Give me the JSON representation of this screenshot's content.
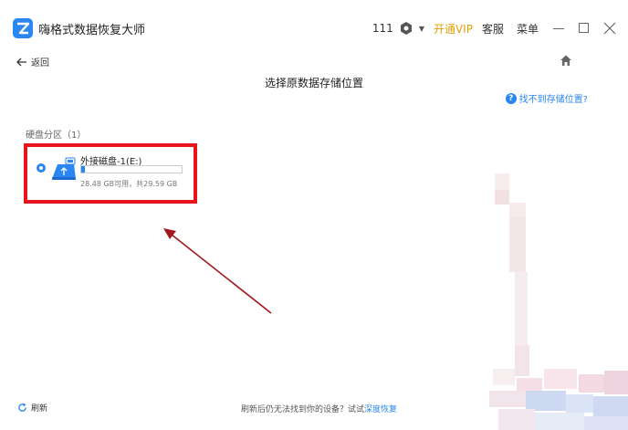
{
  "app": {
    "title": "嗨格式数据恢复大师"
  },
  "titlebar": {
    "user_id": "111",
    "vip_label": "开通VIP",
    "service_label": "客服",
    "menu_label": "菜单"
  },
  "nav": {
    "back_label": "返回"
  },
  "page": {
    "title": "选择原数据存储位置",
    "help_link": "找不到存储位置?"
  },
  "section": {
    "label": "硬盘分区（1）"
  },
  "drive": {
    "name": "外接磁盘-1(E:)",
    "capacity": "28.48 GB可用，共29.59 GB",
    "used_fraction": 0.037
  },
  "footer": {
    "refresh_label": "刷新",
    "message": "刷新后仍无法找到你的设备？试试",
    "deep_link": "深度恢复"
  },
  "colors": {
    "accent": "#2a86f0",
    "vip": "#e0a000",
    "highlight": "#e8131b"
  }
}
